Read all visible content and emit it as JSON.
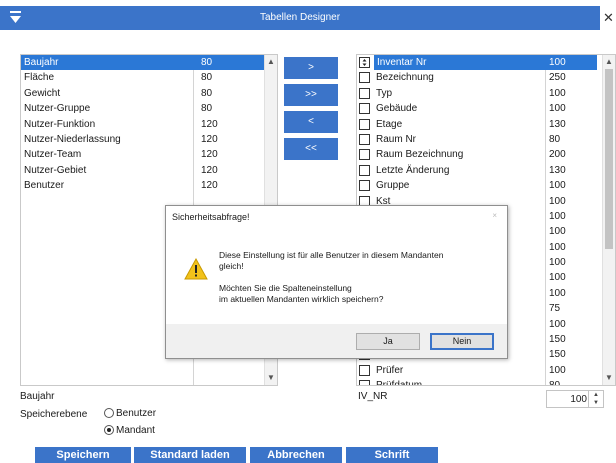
{
  "window": {
    "title": "Tabellen Designer",
    "close_glyph": "✕"
  },
  "left_list": {
    "items": [
      {
        "name": "Baujahr",
        "width": "80",
        "selected": true
      },
      {
        "name": "Fläche",
        "width": "80"
      },
      {
        "name": "Gewicht",
        "width": "80"
      },
      {
        "name": "Nutzer-Gruppe",
        "width": "80"
      },
      {
        "name": "Nutzer-Funktion",
        "width": "120"
      },
      {
        "name": "Nutzer-Niederlassung",
        "width": "120"
      },
      {
        "name": "Nutzer-Team",
        "width": "120"
      },
      {
        "name": "Nutzer-Gebiet",
        "width": "120"
      },
      {
        "name": "Benutzer",
        "width": "120"
      }
    ]
  },
  "transfer_buttons": [
    ">",
    ">>",
    "<",
    "<<"
  ],
  "right_list": {
    "items": [
      {
        "name": "Inventar Nr",
        "width": "100",
        "checked": true,
        "selected": true
      },
      {
        "name": "Bezeichnung",
        "width": "250"
      },
      {
        "name": "Typ",
        "width": "100"
      },
      {
        "name": "Gebäude",
        "width": "100"
      },
      {
        "name": "Etage",
        "width": "130"
      },
      {
        "name": "Raum Nr",
        "width": "80"
      },
      {
        "name": "Raum Bezeichnung",
        "width": "200"
      },
      {
        "name": "Letzte Änderung",
        "width": "130"
      },
      {
        "name": "Gruppe",
        "width": "100"
      },
      {
        "name": "Kst",
        "width": "100"
      },
      {
        "name": "",
        "width": "100"
      },
      {
        "name": "",
        "width": "100"
      },
      {
        "name": "",
        "width": "100"
      },
      {
        "name": "",
        "width": "100"
      },
      {
        "name": "",
        "width": "100"
      },
      {
        "name": "",
        "width": "100"
      },
      {
        "name": "",
        "width": "75"
      },
      {
        "name": "",
        "width": "100"
      },
      {
        "name": "",
        "width": "150"
      },
      {
        "name": "",
        "width": "150"
      },
      {
        "name": "Prüfer",
        "width": "100"
      },
      {
        "name": "Prüfdatum",
        "width": "80"
      }
    ]
  },
  "bottom": {
    "left_field_label": "Baujahr",
    "right_field_label": "IV_NR",
    "speicherebene_label": "Speicherebene",
    "radio_benutzer": "Benutzer",
    "radio_mandant": "Mandant",
    "selected_radio": "Mandant",
    "width_value": "100"
  },
  "footer_buttons": [
    "Speichern",
    "Standard laden",
    "Abbrechen",
    "Schrift"
  ],
  "dialog": {
    "title": "Sicherheitsabfrage!",
    "close_glyph": "×",
    "message_lines": [
      "Diese Einstellung ist für alle Benutzer in diesem Mandanten",
      "gleich!",
      "",
      "Möchten Sie die Spalteneinstellung",
      "im aktuellen Mandanten wirklich speichern?"
    ],
    "yes_label": "Ja",
    "no_label": "Nein",
    "icon": "warning-icon"
  },
  "colors": {
    "accent": "#3b74c9",
    "selection": "#2b78d6",
    "warning": "#f2c21b"
  }
}
